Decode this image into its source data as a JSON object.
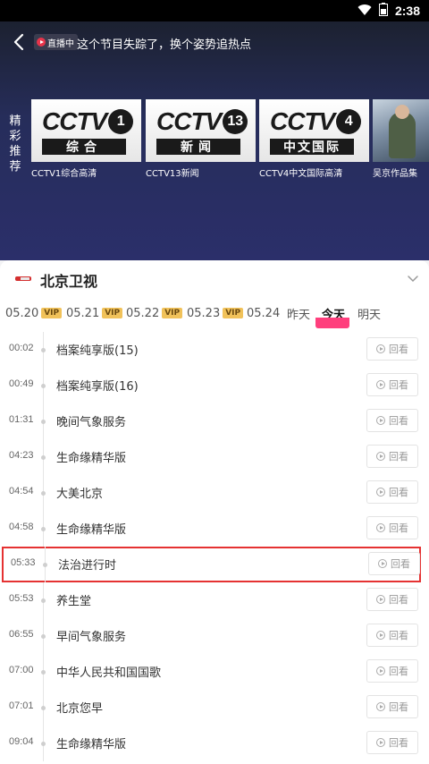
{
  "status_bar": {
    "time": "2:38"
  },
  "top_bar": {
    "live_badge": "直播中",
    "message": "这个节目失踪了，换个姿势追热点"
  },
  "recommend": {
    "label": "精彩推荐",
    "cards": [
      {
        "cctv": "CCTV",
        "number": "1",
        "name": "综合",
        "title": "CCTV1综合高清"
      },
      {
        "cctv": "CCTV",
        "number": "13",
        "name": "新闻",
        "title": "CCTV13新闻"
      },
      {
        "cctv": "CCTV",
        "number": "4",
        "name": "中文国际",
        "title": "CCTV4中文国际高清"
      },
      {
        "title": "吴京作品集"
      }
    ]
  },
  "channel": {
    "name": "北京卫视",
    "dates": [
      {
        "label": "05.20",
        "vip": "VIP"
      },
      {
        "label": "05.21",
        "vip": "VIP"
      },
      {
        "label": "05.22",
        "vip": "VIP"
      },
      {
        "label": "05.23",
        "vip": "VIP"
      },
      {
        "label": "05.24"
      },
      {
        "label": "昨天"
      },
      {
        "label": "今天",
        "active": true
      },
      {
        "label": "明天"
      }
    ],
    "replay_label": "回看",
    "programs": [
      {
        "time": "00:02",
        "title": "档案纯享版(15)"
      },
      {
        "time": "00:49",
        "title": "档案纯享版(16)"
      },
      {
        "time": "01:31",
        "title": "晚间气象服务"
      },
      {
        "time": "04:23",
        "title": "生命缘精华版"
      },
      {
        "time": "04:54",
        "title": "大美北京"
      },
      {
        "time": "04:58",
        "title": "生命缘精华版"
      },
      {
        "time": "05:33",
        "title": "法治进行时",
        "highlighted": true
      },
      {
        "time": "05:53",
        "title": "养生堂"
      },
      {
        "time": "06:55",
        "title": "早间气象服务"
      },
      {
        "time": "07:00",
        "title": "中华人民共和国国歌"
      },
      {
        "time": "07:01",
        "title": "北京您早"
      },
      {
        "time": "09:04",
        "title": "生命缘精华版"
      }
    ]
  },
  "colors": {
    "accent": "#ff3f7d",
    "highlight_border": "#e53232",
    "vip_bg": "#f1c25a"
  }
}
